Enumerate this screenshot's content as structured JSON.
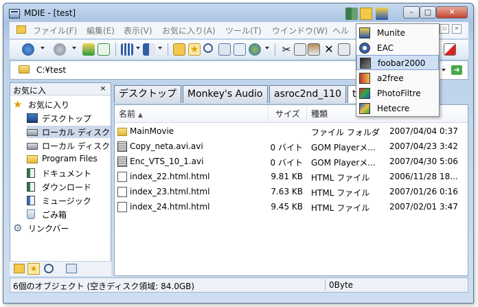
{
  "window": {
    "title": "MDIE - [test]"
  },
  "menu": {
    "items": [
      "ファイル(F)",
      "編集(E)",
      "表示(V)",
      "お気に入り(A)",
      "ツール(T)",
      "ウインドウ(W)",
      "ヘル"
    ]
  },
  "address": {
    "path": "C:¥test"
  },
  "left_pane": {
    "title": "お気に入",
    "close_label": "×",
    "items": [
      {
        "label": "お気に入り",
        "icon": "star-icon"
      },
      {
        "label": "デスクトップ",
        "icon": "desktop-icon"
      },
      {
        "label": "ローカル ディスク",
        "icon": "drive-icon"
      },
      {
        "label": "ローカル ディスク",
        "icon": "drive-icon"
      },
      {
        "label": "Program Files",
        "icon": "folder-icon"
      },
      {
        "label": "ドキュメント",
        "icon": "document-icon"
      },
      {
        "label": "ダウンロード",
        "icon": "download-icon"
      },
      {
        "label": "ミュージック",
        "icon": "music-icon"
      },
      {
        "label": "ごみ箱",
        "icon": "recycle-bin-icon"
      },
      {
        "label": "リンクバー",
        "icon": "gear-icon"
      }
    ]
  },
  "tabs": [
    "デスクトップ",
    "Monkey's Audio",
    "asroc2nd_110",
    "te"
  ],
  "columns": {
    "name": "名前",
    "size": "サイズ",
    "type": "種類"
  },
  "files": [
    {
      "name": "MainMovie",
      "size": "",
      "type": "ファイル フォルダ",
      "date": "2007/04/04 0:37",
      "icon": "folder-icon"
    },
    {
      "name": "Copy_neta.avi.avi",
      "size": "0 バイト",
      "type": "GOM Playerメ...",
      "date": "2007/04/23 3:42",
      "icon": "video-file-icon"
    },
    {
      "name": "Enc_VTS_10_1.avi",
      "size": "0 バイト",
      "type": "GOM Playerメ...",
      "date": "2007/04/30 5:06",
      "icon": "video-file-icon"
    },
    {
      "name": "index_22.html.html",
      "size": "9.81 KB",
      "type": "HTML ファイル",
      "date": "2006/11/28 18...",
      "icon": "html-file-icon"
    },
    {
      "name": "index_23.html.html",
      "size": "7.63 KB",
      "type": "HTML ファイル",
      "date": "2007/01/26 0:16",
      "icon": "html-file-icon"
    },
    {
      "name": "index_24.html.html",
      "size": "9.45 KB",
      "type": "HTML ファイル",
      "date": "2007/02/01 3:47",
      "icon": "html-file-icon"
    }
  ],
  "status": {
    "objects": "6個のオブジェクト (空きディスク領域: 84.0GB)",
    "size": "0Byte"
  },
  "popup": {
    "items": [
      {
        "label": "Munite",
        "highlighted": false
      },
      {
        "label": "EAC",
        "highlighted": false
      },
      {
        "label": "foobar2000",
        "highlighted": true
      },
      {
        "label": "a2free",
        "highlighted": false
      },
      {
        "label": "PhotoFiltre",
        "highlighted": false
      },
      {
        "label": "Hetecre",
        "highlighted": false
      }
    ]
  }
}
